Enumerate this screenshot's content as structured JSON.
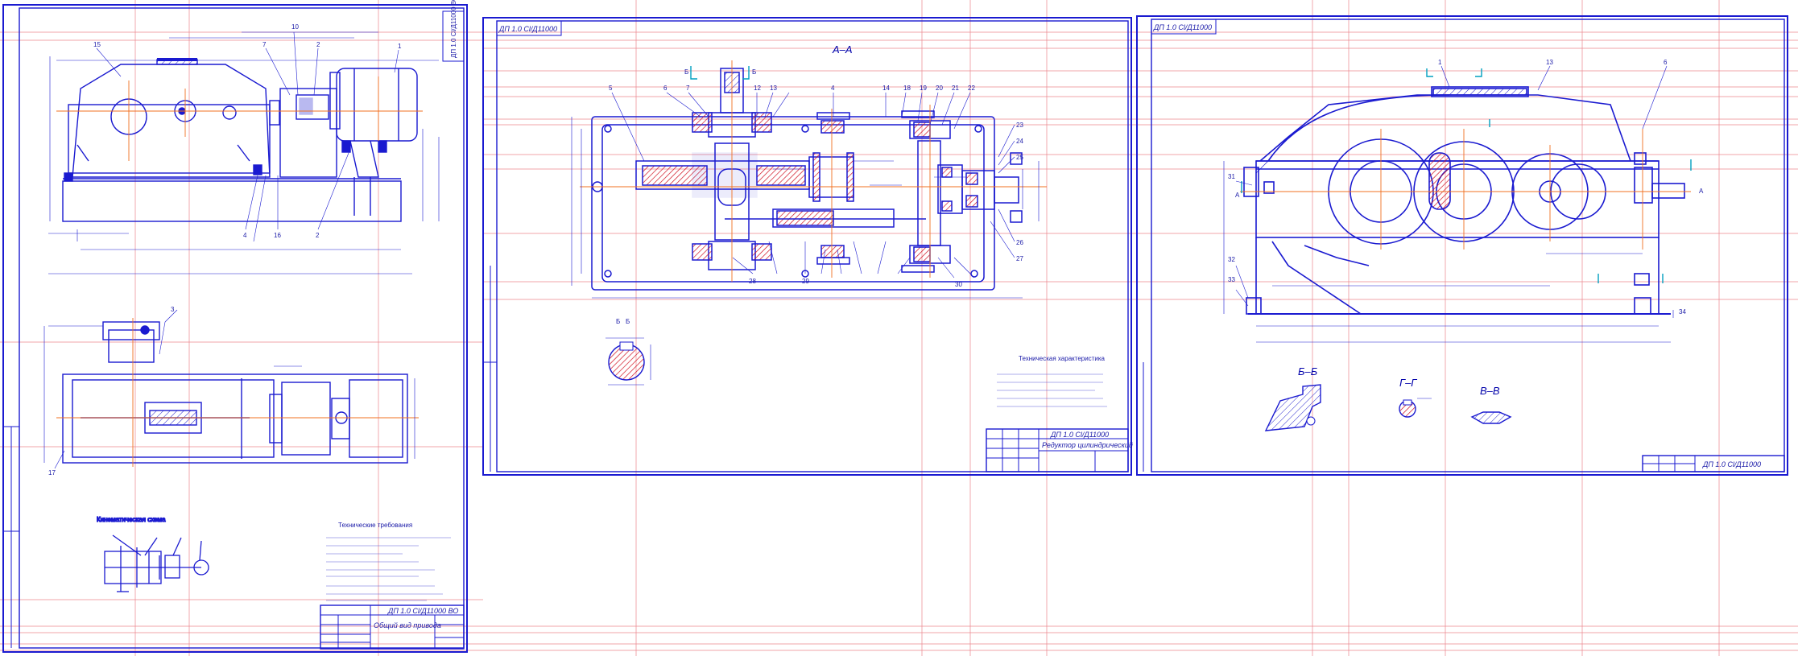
{
  "sheets": [
    {
      "id": "sheet1",
      "stamp_top": "ДП 1.0 Cl/Д11000 ВО",
      "title_block": {
        "code": "ДП 1.0 Cl/Д11000 ВО",
        "name": "Общий вид привода"
      },
      "callouts": [
        "15",
        "1",
        "7",
        "10",
        "2",
        "3",
        "4",
        "16",
        "2",
        "17"
      ],
      "notes_heading": "Технические требования",
      "kinematic_heading": "Кинематическая схема"
    },
    {
      "id": "sheet2",
      "stamp_top": "ДП 1.0 Cl/Д11000",
      "section_title": "А–А",
      "view_b": "Б",
      "callouts": [
        "5",
        "6",
        "7",
        "12",
        "13",
        "4",
        "14",
        "18",
        "19",
        "20",
        "21",
        "22",
        "23",
        "24",
        "25",
        "26",
        "27",
        "28",
        "29",
        "30"
      ],
      "notes_heading": "Техническая характеристика",
      "title_block": {
        "code": "ДП 1.0 Cl/Д11000",
        "name": "Редуктор цилиндрический"
      }
    },
    {
      "id": "sheet3",
      "stamp_top": "ДП 1.0 Cl/Д11000",
      "section_b": "Б–Б",
      "section_g": "Г–Г",
      "section_v": "В–В",
      "view_a": "А",
      "callouts": [
        "1",
        "13",
        "6",
        "31",
        "32",
        "33",
        "34"
      ],
      "title_block": {
        "code": "ДП 1.0 Cl/Д11000"
      }
    }
  ],
  "colors": {
    "outline": "#0000cc",
    "guide_red": "#e0505a",
    "center_orange": "#f07020",
    "cross_cyan": "#00a0c0",
    "section_red": "#d01020"
  }
}
